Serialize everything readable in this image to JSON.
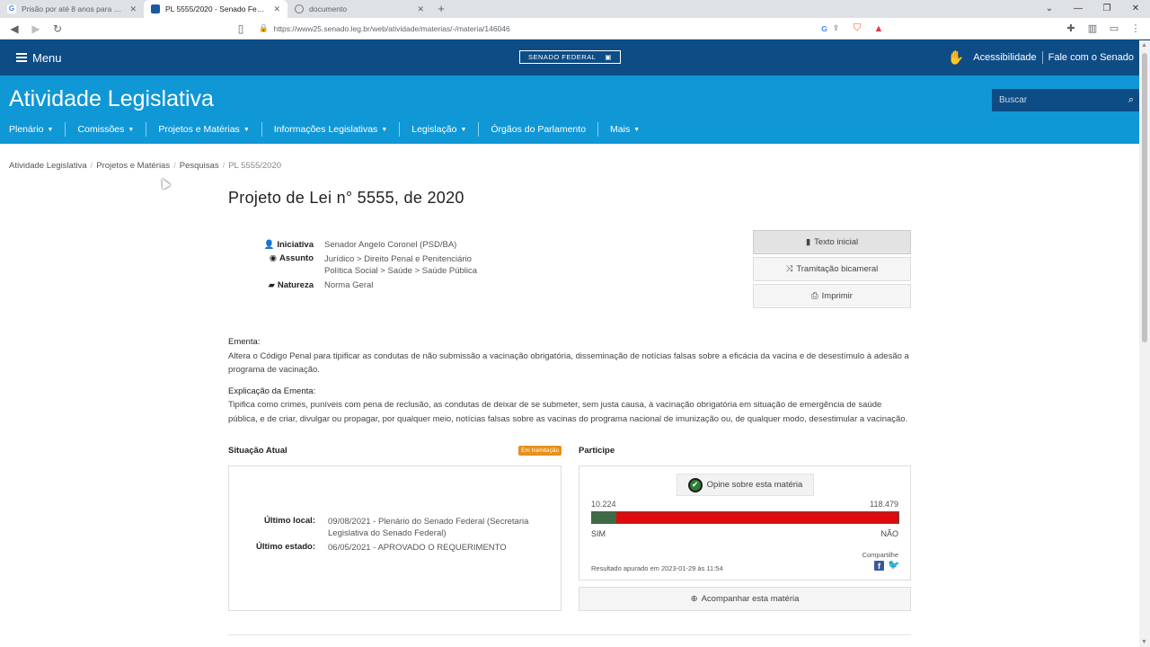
{
  "browser": {
    "tabs": [
      {
        "title": "Prisão por até 8 anos para quem du…",
        "favicon": "G",
        "active": false
      },
      {
        "title": "PL 5555/2020 - Senado Federal",
        "favicon": "senado",
        "active": true
      },
      {
        "title": "documento",
        "favicon": "globe",
        "active": false
      }
    ],
    "new_tab": "+",
    "url": "https://www25.senado.leg.br/web/atividade/materias/-/materia/146046"
  },
  "site": {
    "menu_label": "Menu",
    "logo_text": "SENADO FEDERAL",
    "accessibility": "Acessibilidade",
    "contact": "Fale com o Senado",
    "section_title": "Atividade Legislativa",
    "search_placeholder": "Buscar",
    "nav": [
      {
        "label": "Plenário",
        "caret": true
      },
      {
        "label": "Comissões",
        "caret": true
      },
      {
        "label": "Projetos e Matérias",
        "caret": true
      },
      {
        "label": "Informações Legislativas",
        "caret": true
      },
      {
        "label": "Legislação",
        "caret": true
      },
      {
        "label": "Órgãos do Parlamento",
        "caret": false
      },
      {
        "label": "Mais",
        "caret": true
      }
    ]
  },
  "breadcrumb": [
    "Atividade Legislativa",
    "Projetos e Matérias",
    "Pesquisas",
    "PL 5555/2020"
  ],
  "page_title": "Projeto de Lei n° 5555, de 2020",
  "meta": {
    "iniciativa_label": "Iniciativa",
    "iniciativa": "Senador Angelo Coronel (PSD/BA)",
    "assunto_label": "Assunto",
    "assunto_1": "Jurídico > Direito Penal e Penitenciário",
    "assunto_2": "Política Social > Saúde > Saúde Pública",
    "natureza_label": "Natureza",
    "natureza": "Norma Geral"
  },
  "actions": {
    "texto_inicial": "Texto inicial",
    "tramitacao": "Tramitação bicameral",
    "imprimir": "Imprimir",
    "acompanhar": "Acompanhar esta matéria"
  },
  "ementa": {
    "label": "Ementa:",
    "text": "Altera o Código Penal para tipificar as condutas de não submissão a vacinação obrigatória, disseminação de notícias falsas sobre a eficácia da vacina e de desestímulo à adesão a programa de vacinação.",
    "explicacao_label": "Explicação da Ementa:",
    "explicacao": "Tipifica como crimes, puníveis com pena de reclusão, as condutas de deixar de se submeter, sem justa causa, à vacinação obrigatória em situação de emergência de saúde pública, e de criar, divulgar ou propagar, por qualquer meio, notícias falsas sobre as vacinas do programa nacional de imunização ou, de qualquer modo, desestimular a vacinação."
  },
  "situacao": {
    "title": "Situação Atual",
    "badge": "Em tramitação",
    "ultimo_local_label": "Último local:",
    "ultimo_local": "09/08/2021 - Plenário do Senado Federal (Secretaria Legislativa do Senado Federal)",
    "ultimo_estado_label": "Último estado:",
    "ultimo_estado": "06/05/2021 - APROVADO O REQUERIMENTO"
  },
  "participe": {
    "title": "Participe",
    "opine": "Opine sobre esta matéria",
    "sim_count": "10.224",
    "nao_count": "118.479",
    "sim_fraction": 0.0794,
    "sim_label": "SIM",
    "nao_label": "NÃO",
    "share_label": "Compartilhe",
    "result": "Resultado apurado em 2023-01-29 às 11:54"
  },
  "colors": {
    "header_dark": "#0e4c85",
    "header_band": "#1097d6",
    "badge": "#e8901c",
    "vote_yes": "#3e6b45",
    "vote_no": "#dd0b0b"
  }
}
